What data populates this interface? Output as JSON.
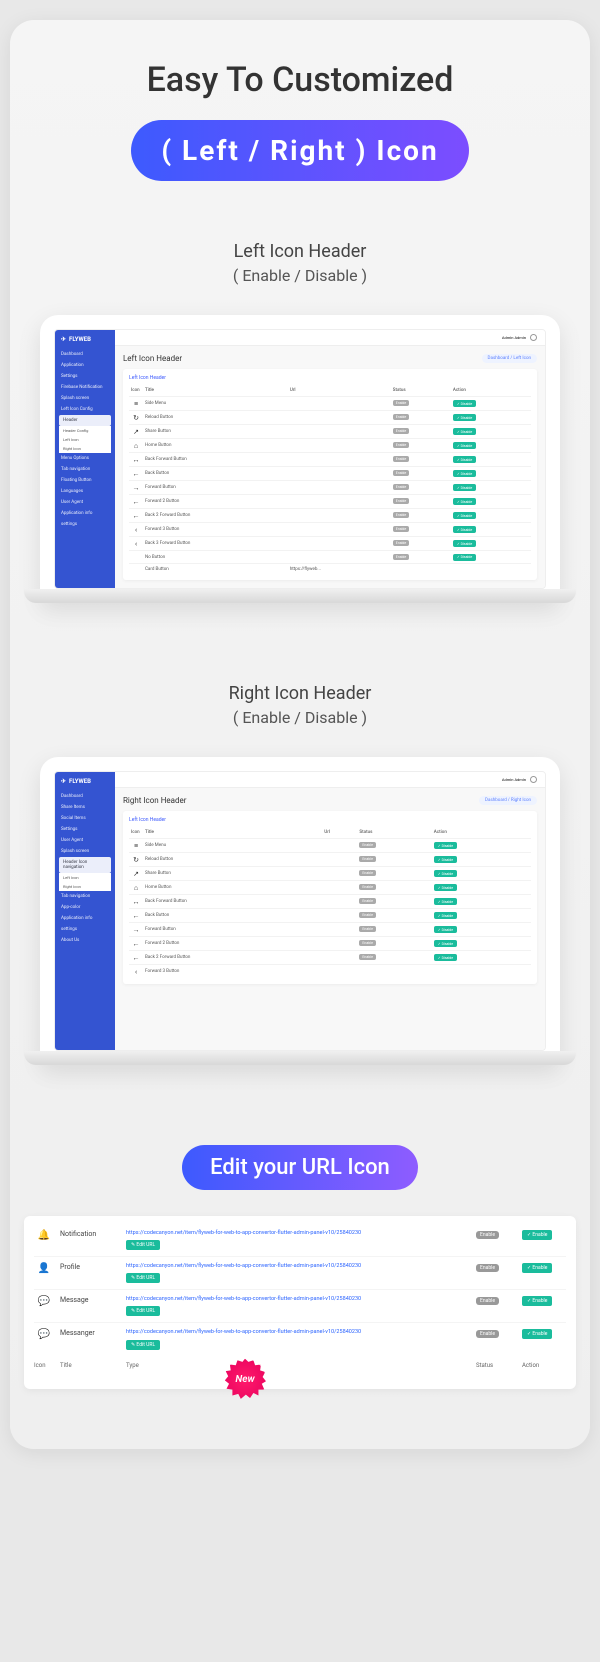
{
  "hero": {
    "title": "Easy To Customized",
    "pill": "( Left / Right ) Icon"
  },
  "section1": {
    "title": "Left Icon Header",
    "sub": "( Enable / Disable )"
  },
  "section2": {
    "title": "Right Icon Header",
    "sub": "( Enable / Disable )"
  },
  "section3": {
    "pill": "Edit your URL Icon"
  },
  "app": {
    "brand": "FLYWEB",
    "topbar_user": "Admin Admin",
    "page1_title": "Left Icon Header",
    "page2_title": "Right Icon Header",
    "breadcrumb1": "Dashboard / Left Icon",
    "breadcrumb2": "Dashboard / Right Icon",
    "card1_title": "Left Icon Header",
    "card2_title": "Left Icon Header",
    "cols": {
      "icon": "Icon",
      "title": "Title",
      "url": "Url",
      "status": "Status",
      "action": "Action"
    }
  },
  "sidebar1": [
    {
      "label": "Dashboard"
    },
    {
      "label": "Application"
    },
    {
      "label": "Settings"
    },
    {
      "label": "Firebase Notification"
    },
    {
      "label": "Splash screen"
    },
    {
      "label": "Left Icon Config"
    },
    {
      "label": "Header",
      "active": true
    },
    {
      "label": "Header Config",
      "sub": true
    },
    {
      "label": "Left Icon",
      "sub": true
    },
    {
      "label": "Right Icon",
      "sub": true
    },
    {
      "label": "Menu Options"
    },
    {
      "label": "Tab navigation"
    },
    {
      "label": "Floating Button"
    },
    {
      "label": "Languages"
    },
    {
      "label": "User Agent"
    },
    {
      "label": "Application info"
    },
    {
      "label": "settings"
    }
  ],
  "sidebar2": [
    {
      "label": "Dashboard"
    },
    {
      "label": "Share Items"
    },
    {
      "label": "Social Items"
    },
    {
      "label": "Settings"
    },
    {
      "label": "User Agent"
    },
    {
      "label": "Splash screen"
    },
    {
      "label": "Header Icon navigation",
      "active": true
    },
    {
      "label": "Left Icon",
      "sub": true
    },
    {
      "label": "Right Icon",
      "sub": true
    },
    {
      "label": "Tab navigation"
    },
    {
      "label": "App-color"
    },
    {
      "label": "Application info"
    },
    {
      "label": "settings"
    },
    {
      "label": "About Us"
    }
  ],
  "rows1": [
    {
      "icon": "≡",
      "title": "Side Menu",
      "url": "",
      "status": "Enable",
      "action": "Disable"
    },
    {
      "icon": "↻",
      "title": "Reload Button",
      "url": "",
      "status": "Enable",
      "action": "Disable"
    },
    {
      "icon": "↗",
      "title": "Share Button",
      "url": "",
      "status": "Enable",
      "action": "Disable"
    },
    {
      "icon": "⌂",
      "title": "Home Button",
      "url": "",
      "status": "Enable",
      "action": "Disable"
    },
    {
      "icon": "↔",
      "title": "Back Forward Button",
      "url": "",
      "status": "Enable",
      "action": "Disable"
    },
    {
      "icon": "←",
      "title": "Back Button",
      "url": "",
      "status": "Enable",
      "action": "Disable"
    },
    {
      "icon": "→",
      "title": "Forward Button",
      "url": "",
      "status": "Enable",
      "action": "Disable"
    },
    {
      "icon": "←",
      "title": "Forward 2 Button",
      "url": "",
      "status": "Enable",
      "action": "Disable"
    },
    {
      "icon": "←",
      "title": "Back 2 Forward Button",
      "url": "",
      "status": "Enable",
      "action": "Disable"
    },
    {
      "icon": "‹",
      "title": "Forward 3 Button",
      "url": "",
      "status": "Enable",
      "action": "Disable"
    },
    {
      "icon": "‹",
      "title": "Back 3 Forward Button",
      "url": "",
      "status": "Enable",
      "action": "Disable"
    },
    {
      "icon": "",
      "title": "No Button",
      "url": "",
      "status": "Enable",
      "action": "Disable"
    },
    {
      "icon": "",
      "title": "Card Button",
      "url": "https://flyweb...",
      "status": "",
      "action": ""
    }
  ],
  "rows2": [
    {
      "icon": "≡",
      "title": "Side Menu",
      "url": "",
      "status": "Enable",
      "action": "Disable"
    },
    {
      "icon": "↻",
      "title": "Reload Button",
      "url": "",
      "status": "Enable",
      "action": "Disable"
    },
    {
      "icon": "↗",
      "title": "Share Button",
      "url": "",
      "status": "Enable",
      "action": "Disable"
    },
    {
      "icon": "⌂",
      "title": "Home Button",
      "url": "",
      "status": "Enable",
      "action": "Disable"
    },
    {
      "icon": "↔",
      "title": "Back Forward Button",
      "url": "",
      "status": "Enable",
      "action": "Disable"
    },
    {
      "icon": "←",
      "title": "Back Button",
      "url": "",
      "status": "Enable",
      "action": "Disable"
    },
    {
      "icon": "→",
      "title": "Forward Button",
      "url": "",
      "status": "Enable",
      "action": "Disable"
    },
    {
      "icon": "←",
      "title": "Forward 2 Button",
      "url": "",
      "status": "Enable",
      "action": "Disable"
    },
    {
      "icon": "←",
      "title": "Back 2 Forward Button",
      "url": "",
      "status": "Enable",
      "action": "Disable"
    },
    {
      "icon": "‹",
      "title": "Forward 3 Button",
      "url": "",
      "status": "",
      "action": ""
    }
  ],
  "url_rows": [
    {
      "icon": "🔔",
      "title": "Notification",
      "url": "https://codecanyon.net/item/flyweb-for-web-to-app-convertor-flutter-admin-panel-v10/25840230",
      "status": "Enable",
      "action": "✓ Enable",
      "edit": "✎ Edit URL"
    },
    {
      "icon": "👤",
      "title": "Profile",
      "url": "https://codecanyon.net/item/flyweb-for-web-to-app-convertor-flutter-admin-panel-v10/25840230",
      "status": "Enable",
      "action": "✓ Enable",
      "edit": "✎ Edit URL"
    },
    {
      "icon": "💬",
      "title": "Message",
      "url": "https://codecanyon.net/item/flyweb-for-web-to-app-convertor-flutter-admin-panel-v10/25840230",
      "status": "Enable",
      "action": "✓ Enable",
      "edit": "✎ Edit URL"
    },
    {
      "icon": "💬",
      "title": "Messanger",
      "url": "https://codecanyon.net/item/flyweb-for-web-to-app-convertor-flutter-admin-panel-v10/25840230",
      "status": "Enable",
      "action": "✓ Enable",
      "edit": "✎ Edit URL"
    }
  ],
  "url_head": {
    "icon": "Icon",
    "title": "Title",
    "type": "Type",
    "status": "Status",
    "action": "Action"
  },
  "new_badge": "New"
}
